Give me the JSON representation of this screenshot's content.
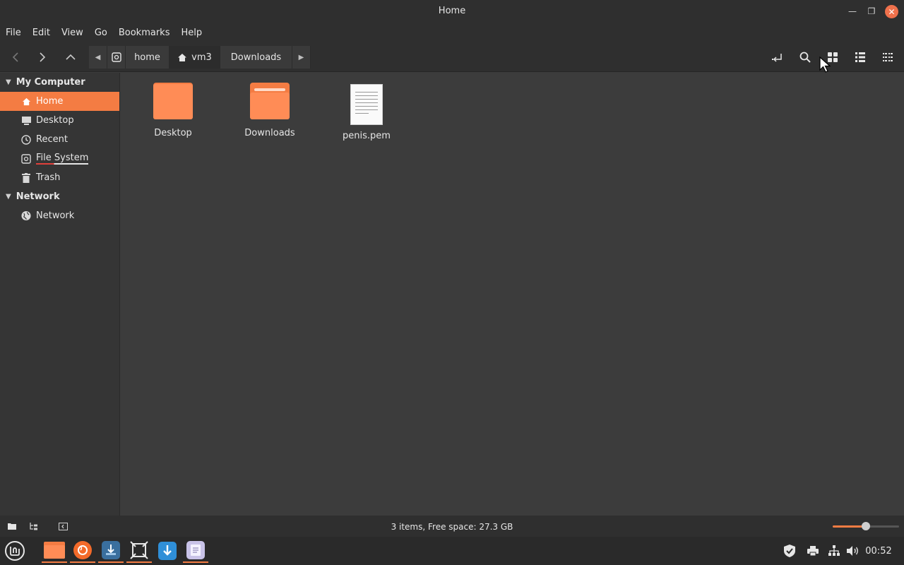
{
  "window": {
    "title": "Home"
  },
  "menu": {
    "items": [
      "File",
      "Edit",
      "View",
      "Go",
      "Bookmarks",
      "Help"
    ]
  },
  "pathbar": {
    "crumbs": [
      "home",
      "vm3",
      "Downloads"
    ]
  },
  "sidebar": {
    "sections": [
      {
        "title": "My Computer",
        "items": [
          "Home",
          "Desktop",
          "Recent",
          "File System",
          "Trash"
        ]
      },
      {
        "title": "Network",
        "items": [
          "Network"
        ]
      }
    ],
    "selected": "Home"
  },
  "files": [
    {
      "name": "Desktop",
      "icon": "folder-icon"
    },
    {
      "name": "Downloads",
      "icon": "folder-icon"
    },
    {
      "name": "penis.pem",
      "icon": "document-icon"
    }
  ],
  "statusbar": {
    "text": "3 items, Free space: 27.3 GB",
    "zoom_level": 0.5
  },
  "taskbar": {
    "clock": "00:52"
  },
  "colors": {
    "accent": "#f47c43",
    "close": "#f0714c"
  }
}
